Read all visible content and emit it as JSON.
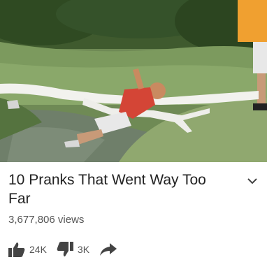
{
  "video": {
    "title": "10 Pranks That Went Way Too Far",
    "views": "3,677,806 views"
  },
  "actions": {
    "like_count": "24K",
    "dislike_count": "3K"
  },
  "icons": {
    "more": "chevron-down-icon",
    "like": "thumbs-up-icon",
    "dislike": "thumbs-down-icon",
    "share": "share-arrow-icon"
  },
  "colors": {
    "title_text": "#222222",
    "meta_text": "#555555",
    "icon": "#444444"
  }
}
